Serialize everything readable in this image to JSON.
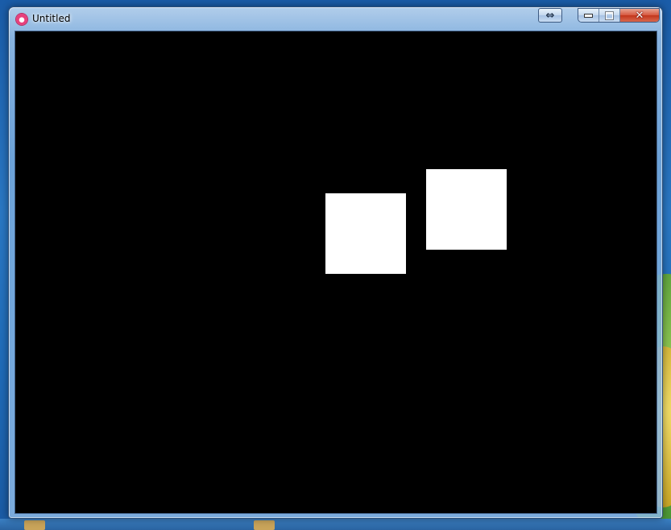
{
  "window": {
    "title": "Untitled",
    "app_icon": "app-logo-icon",
    "controls": {
      "resize_icon": "resize-arrows-icon",
      "resize_glyph": "⇔",
      "minimize_icon": "minimize-icon",
      "maximize_icon": "maximize-icon",
      "close_icon": "close-icon",
      "close_glyph": "✕"
    }
  },
  "canvas": {
    "background": "#000000",
    "shape_color": "#ffffff"
  }
}
